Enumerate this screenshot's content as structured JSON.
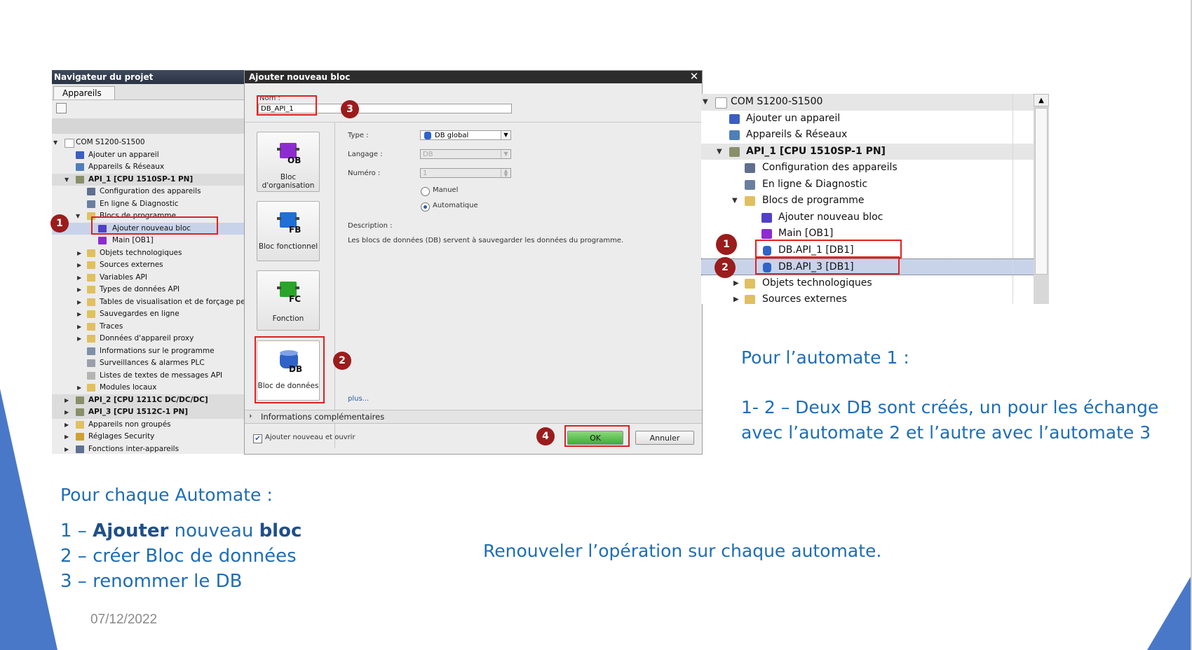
{
  "navigator": {
    "title": "Navigateur du projet",
    "tab": "Appareils",
    "items": [
      {
        "label": "COM S1200-S1500",
        "icon": "project-icon"
      },
      {
        "label": "Ajouter un appareil",
        "icon": "add-device-icon"
      },
      {
        "label": "Appareils & Réseaux",
        "icon": "network-icon"
      },
      {
        "label": "API_1 [CPU 1510SP-1 PN]",
        "icon": "cpu-icon"
      },
      {
        "label": "Configuration des appareils",
        "icon": "device-config-icon"
      },
      {
        "label": "En ligne & Diagnostic",
        "icon": "diagnostic-icon"
      },
      {
        "label": "Blocs de programme",
        "icon": "folder-icon"
      },
      {
        "label": "Ajouter nouveau bloc",
        "icon": "add-block-icon"
      },
      {
        "label": "Main [OB1]",
        "icon": "ob-block-icon"
      },
      {
        "label": "Objets technologiques",
        "icon": "folder-icon"
      },
      {
        "label": "Sources externes",
        "icon": "folder-icon"
      },
      {
        "label": "Variables API",
        "icon": "folder-icon"
      },
      {
        "label": "Types de données API",
        "icon": "folder-icon"
      },
      {
        "label": "Tables de visualisation et de forçage pe",
        "icon": "folder-icon"
      },
      {
        "label": "Sauvegardes en ligne",
        "icon": "folder-icon"
      },
      {
        "label": "Traces",
        "icon": "folder-icon"
      },
      {
        "label": "Données d'appareil proxy",
        "icon": "folder-icon"
      },
      {
        "label": "Informations sur le programme",
        "icon": "info-icon"
      },
      {
        "label": "Surveillances & alarmes PLC",
        "icon": "alarm-icon"
      },
      {
        "label": "Listes de textes de messages API",
        "icon": "text-list-icon"
      },
      {
        "label": "Modules locaux",
        "icon": "folder-icon"
      },
      {
        "label": "API_2 [CPU 1211C DC/DC/DC]",
        "icon": "cpu-icon"
      },
      {
        "label": "API_3 [CPU 1512C-1 PN]",
        "icon": "cpu-icon"
      },
      {
        "label": "Appareils non groupés",
        "icon": "folder-icon"
      },
      {
        "label": "Réglages Security",
        "icon": "security-icon"
      },
      {
        "label": "Fonctions inter-appareils",
        "icon": "cross-device-icon"
      }
    ]
  },
  "dialog": {
    "title": "Ajouter nouveau bloc",
    "name_label": "Nom :",
    "name_value": "DB_API_1",
    "blocks": [
      {
        "code": "OB",
        "label": "Bloc d'organisation",
        "color": "#8d2bd0"
      },
      {
        "code": "FB",
        "label": "Bloc fonctionnel",
        "color": "#1f6fd6"
      },
      {
        "code": "FC",
        "label": "Fonction",
        "color": "#2aa52a"
      },
      {
        "code": "DB",
        "label": "Bloc de données",
        "color": "#2f63c9"
      }
    ],
    "type_label": "Type :",
    "type_value": "DB global",
    "language_label": "Langage :",
    "language_value": "DB",
    "number_label": "Numéro :",
    "number_value": "1",
    "radio_manual": "Manuel",
    "radio_auto": "Automatique",
    "description_label": "Description :",
    "description_text": "Les blocs de données (DB) servent à sauvegarder les données du programme.",
    "more_link": "plus...",
    "extra_info": "Informations complémentaires",
    "checkbox_label": "Ajouter nouveau et ouvrir",
    "ok": "OK",
    "cancel": "Annuler"
  },
  "right_tree": {
    "items": [
      {
        "label": "COM S1200-S1500",
        "icon": "project-icon"
      },
      {
        "label": "Ajouter un appareil",
        "icon": "add-device-icon"
      },
      {
        "label": "Appareils & Réseaux",
        "icon": "network-icon"
      },
      {
        "label": "API_1 [CPU 1510SP-1 PN]",
        "icon": "cpu-icon"
      },
      {
        "label": "Configuration des appareils",
        "icon": "device-config-icon"
      },
      {
        "label": "En ligne & Diagnostic",
        "icon": "diagnostic-icon"
      },
      {
        "label": "Blocs de programme",
        "icon": "folder-icon"
      },
      {
        "label": "Ajouter nouveau bloc",
        "icon": "add-block-icon"
      },
      {
        "label": "Main [OB1]",
        "icon": "ob-block-icon"
      },
      {
        "label": "DB.API_1 [DB1]",
        "icon": "db-block-icon"
      },
      {
        "label": "DB.API_3 [DB1]",
        "icon": "db-block-icon"
      },
      {
        "label": "Objets technologiques",
        "icon": "folder-icon"
      },
      {
        "label": "Sources externes",
        "icon": "folder-icon"
      }
    ]
  },
  "badges": [
    "1",
    "2",
    "3",
    "4"
  ],
  "slide": {
    "right_title": "Pour l’automate 1 :",
    "right_line1": "1- 2 – Deux DB sont créés, un pour les échange",
    "right_line2": "avec l’automate 2 et l’autre avec l’automate 3",
    "left_title": "Pour chaque Automate :",
    "step1_prefix": "1 – ",
    "step1_bold1": "Ajouter",
    "step1_mid": " nouveau ",
    "step1_bold2": "bloc",
    "step2": "2 – créer Bloc de données",
    "step3": "3 – renommer le DB",
    "center_text": "Renouveler l’opération sur chaque automate.",
    "date": "07/12/2022"
  },
  "colors": {
    "accent_text": "#1f6db5",
    "highlight_red": "#e02020",
    "badge": "#9b1c1c",
    "deco_blue": "#4a78c8"
  }
}
